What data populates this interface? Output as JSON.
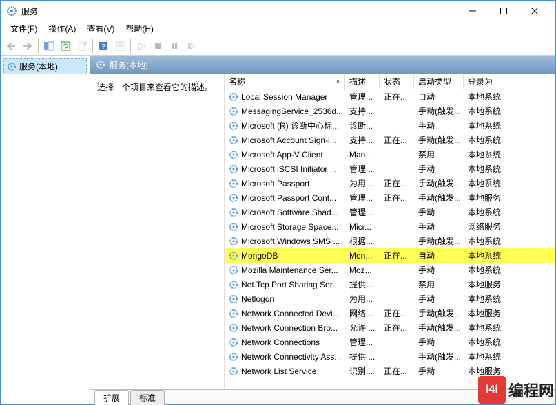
{
  "window": {
    "title": "服务"
  },
  "menu": {
    "file": "文件(F)",
    "action": "操作(A)",
    "view": "查看(V)",
    "help": "帮助(H)"
  },
  "tree": {
    "root": "服务(本地)"
  },
  "right": {
    "header": "服务(本地)",
    "desc_hint": "选择一个项目来查看它的描述。"
  },
  "columns": {
    "name": "名称",
    "desc": "描述",
    "status": "状态",
    "startup": "启动类型",
    "logon": "登录为"
  },
  "tabs": {
    "ext": "扩展",
    "std": "标准"
  },
  "watermark": {
    "logo": "l4i",
    "text": "编程网"
  },
  "rows": [
    {
      "name": "Local Session Manager",
      "desc": "管理...",
      "status": "正在...",
      "startup": "自动",
      "logon": "本地系统"
    },
    {
      "name": "MessagingService_2536d...",
      "desc": "支持...",
      "status": "",
      "startup": "手动(触发...",
      "logon": "本地系统"
    },
    {
      "name": "Microsoft (R) 诊断中心标...",
      "desc": "诊断...",
      "status": "",
      "startup": "手动",
      "logon": "本地系统"
    },
    {
      "name": "Microsoft Account Sign-i...",
      "desc": "支持...",
      "status": "正在...",
      "startup": "手动(触发...",
      "logon": "本地系统"
    },
    {
      "name": "Microsoft App-V Client",
      "desc": "Man...",
      "status": "",
      "startup": "禁用",
      "logon": "本地系统"
    },
    {
      "name": "Microsoft iSCSI Initiator ...",
      "desc": "管理...",
      "status": "",
      "startup": "手动",
      "logon": "本地系统"
    },
    {
      "name": "Microsoft Passport",
      "desc": "为用...",
      "status": "正在...",
      "startup": "手动(触发...",
      "logon": "本地系统"
    },
    {
      "name": "Microsoft Passport Cont...",
      "desc": "管理...",
      "status": "正在...",
      "startup": "手动(触发...",
      "logon": "本地服务"
    },
    {
      "name": "Microsoft Software Shad...",
      "desc": "管理...",
      "status": "",
      "startup": "手动",
      "logon": "本地系统"
    },
    {
      "name": "Microsoft Storage Space...",
      "desc": "Micr...",
      "status": "",
      "startup": "手动",
      "logon": "网络服务"
    },
    {
      "name": "Microsoft Windows SMS ...",
      "desc": "根据...",
      "status": "",
      "startup": "手动(触发...",
      "logon": "本地系统"
    },
    {
      "name": "MongoDB",
      "desc": "Mon...",
      "status": "正在...",
      "startup": "自动",
      "logon": "本地系统",
      "highlight": true
    },
    {
      "name": "Mozilla Maintenance Ser...",
      "desc": "Moz...",
      "status": "",
      "startup": "手动",
      "logon": "本地系统"
    },
    {
      "name": "Net.Tcp Port Sharing Ser...",
      "desc": "提供...",
      "status": "",
      "startup": "禁用",
      "logon": "本地服务"
    },
    {
      "name": "Netlogon",
      "desc": "为用...",
      "status": "",
      "startup": "手动",
      "logon": "本地系统"
    },
    {
      "name": "Network Connected Devi...",
      "desc": "网络...",
      "status": "正在...",
      "startup": "手动(触发...",
      "logon": "本地服务"
    },
    {
      "name": "Network Connection Bro...",
      "desc": "允许 ...",
      "status": "正在...",
      "startup": "手动(触发...",
      "logon": "本地系统"
    },
    {
      "name": "Network Connections",
      "desc": "管理...",
      "status": "",
      "startup": "手动",
      "logon": "本地系统"
    },
    {
      "name": "Network Connectivity Ass...",
      "desc": "提供 ...",
      "status": "",
      "startup": "手动(触发...",
      "logon": "本地系统"
    },
    {
      "name": "Network List Service",
      "desc": "识别...",
      "status": "正在...",
      "startup": "手动",
      "logon": "本地服务"
    }
  ]
}
